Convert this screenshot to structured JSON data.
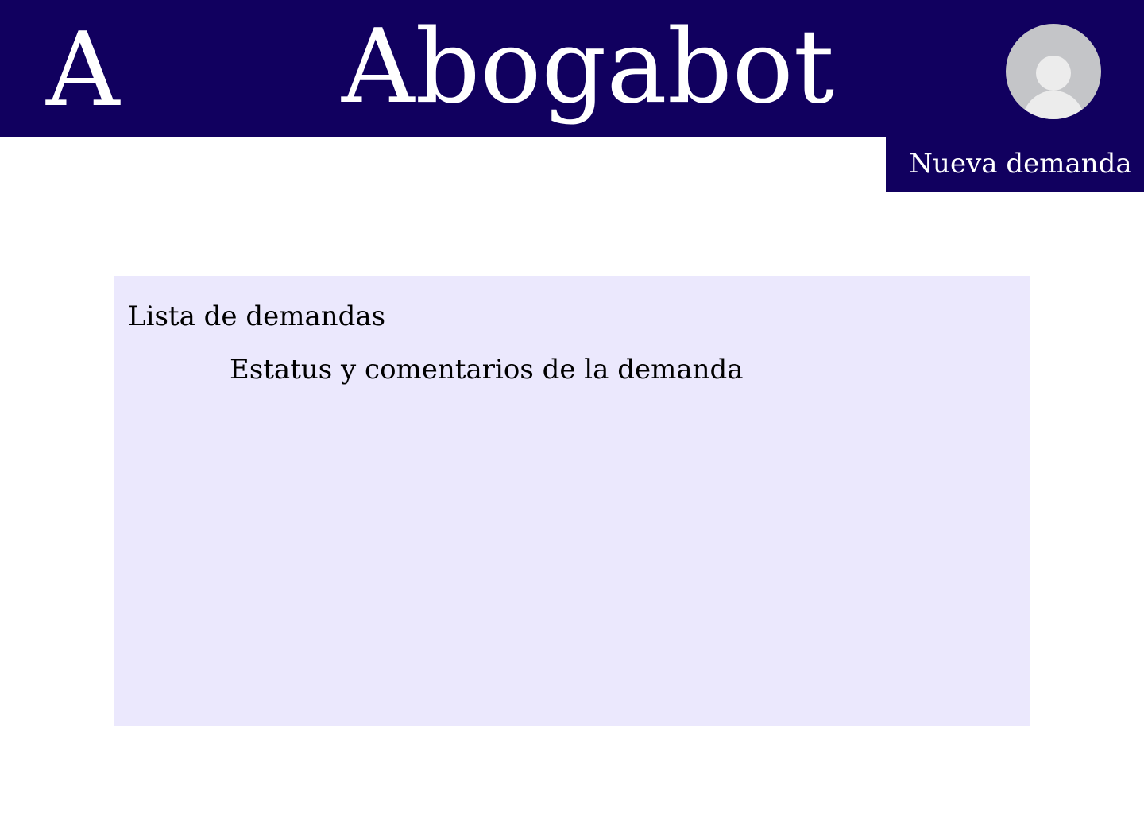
{
  "header": {
    "logo_letter": "A",
    "app_title": "Abogabot",
    "background_color": "#11005f"
  },
  "user": {
    "avatar_icon": "user-avatar-icon"
  },
  "actions": {
    "new_label": "Nueva demanda"
  },
  "main": {
    "list_title": "Lista de demandas",
    "status_heading": "Estatus y comentarios de la demanda",
    "panel_color": "#ebe8fd"
  }
}
